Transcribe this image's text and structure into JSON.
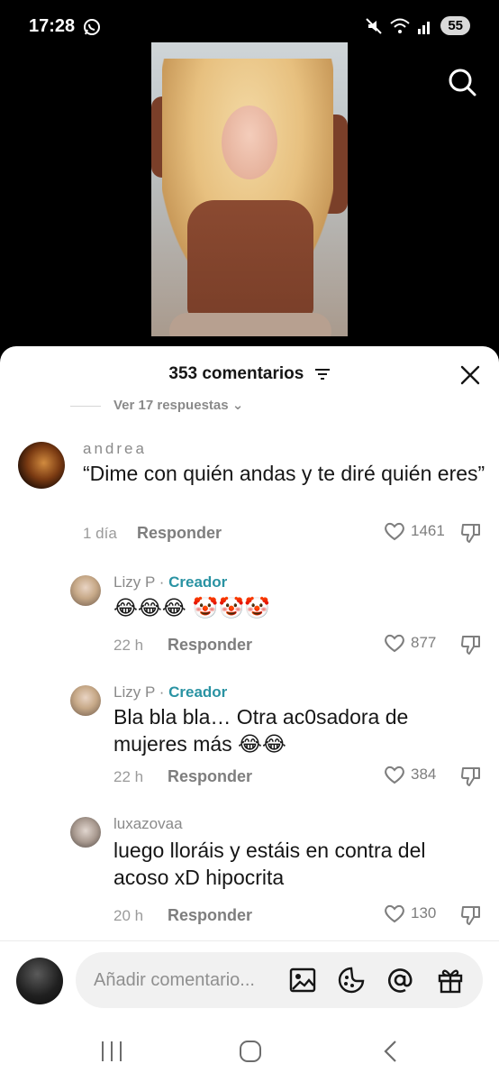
{
  "status_bar": {
    "time": "17:28",
    "battery": "55",
    "icons": [
      "whatsapp-icon",
      "mute-icon",
      "wifi-icon",
      "signal-icon"
    ]
  },
  "video": {
    "search_icon": "search-icon"
  },
  "sheet": {
    "title": "353 comentarios",
    "close_icon": "close-icon",
    "filter_icon": "filter-icon",
    "replies_link": "Ver 17 respuestas ⌄"
  },
  "comments": [
    {
      "author": "andrea",
      "text": "“Dime con quién andas y te diré quién eres”",
      "time": "1 día",
      "reply_label": "Responder",
      "likes": "1461"
    },
    {
      "author": "Lizy P",
      "separator": " · ",
      "badge": "Creador",
      "text": "😂😂😂 🤡🤡🤡",
      "time": "22 h",
      "reply_label": "Responder",
      "likes": "877"
    },
    {
      "author": "Lizy P",
      "separator": " · ",
      "badge": "Creador",
      "text": "Bla bla bla… Otra ac0sadora de mujeres más 😂😂",
      "time": "22 h",
      "reply_label": "Responder",
      "likes": "384"
    },
    {
      "author": "luxazovaa",
      "text": "luego lloráis y estáis en contra del acoso xD hipocrita",
      "time": "20 h",
      "reply_label": "Responder",
      "likes": "130"
    }
  ],
  "composer": {
    "placeholder": "Añadir comentario...",
    "icons": [
      "image-icon",
      "sticker-icon",
      "mention-icon",
      "gift-icon"
    ]
  },
  "nav": {
    "icons": [
      "recents-icon",
      "home-icon",
      "back-icon"
    ]
  },
  "colors": {
    "creator": "#2a93a3",
    "meta": "#9b9b9b",
    "text": "#161616"
  }
}
